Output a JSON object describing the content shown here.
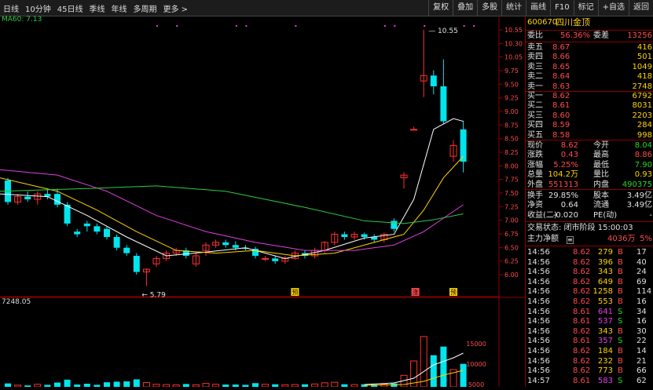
{
  "toolbar": {
    "left_items": [
      "日线",
      "10分钟",
      "45日线",
      "季线",
      "年线",
      "多周期",
      "更多 >"
    ],
    "right_items": [
      "复权",
      "叠加",
      "多股",
      "统计",
      "画线",
      "F10",
      "标记",
      "+自选",
      "返回"
    ]
  },
  "chart": {
    "ma_label": "MA60: 7.13",
    "volume_label": "7248.05",
    "price_ticks": [
      "10.55",
      "10.30",
      "10.05",
      "9.75",
      "9.50",
      "9.25",
      "9.00",
      "8.75",
      "8.50",
      "8.25",
      "8.00",
      "7.75",
      "7.50",
      "7.25",
      "7.00",
      "6.75",
      "6.50",
      "6.25",
      "6.00"
    ],
    "volume_ticks": [
      "15000",
      "10000",
      "5000"
    ],
    "high_label": "10.55",
    "low_label": "5.79",
    "markers": [
      "预",
      "涨",
      "预"
    ]
  },
  "quote": {
    "code": "600670",
    "name": "四川金顶",
    "weibi_label": "委比",
    "weibi_value": "56.36%",
    "weicha_label": "委差",
    "weicha_value": "13256",
    "asks": [
      {
        "label": "卖五",
        "price": "8.67",
        "vol": "416"
      },
      {
        "label": "卖四",
        "price": "8.66",
        "vol": "501"
      },
      {
        "label": "卖三",
        "price": "8.65",
        "vol": "1049"
      },
      {
        "label": "卖二",
        "price": "8.64",
        "vol": "418"
      },
      {
        "label": "卖一",
        "price": "8.63",
        "vol": "2748"
      }
    ],
    "bids": [
      {
        "label": "买一",
        "price": "8.62",
        "vol": "6792"
      },
      {
        "label": "买二",
        "price": "8.61",
        "vol": "8031"
      },
      {
        "label": "买三",
        "price": "8.60",
        "vol": "2203"
      },
      {
        "label": "买四",
        "price": "8.59",
        "vol": "284"
      },
      {
        "label": "买五",
        "price": "8.58",
        "vol": "998"
      }
    ],
    "stats": [
      {
        "l1": "现价",
        "v1": "8.62",
        "l2": "今开",
        "v2": "8.04"
      },
      {
        "l1": "涨跌",
        "v1": "0.43",
        "l2": "最高",
        "v2": "8.86"
      },
      {
        "l1": "涨幅",
        "v1": "5.25%",
        "l2": "最低",
        "v2": "7.90"
      },
      {
        "l1": "总量",
        "v1": "104.2万",
        "l2": "量比",
        "v2": "0.93"
      },
      {
        "l1": "外盘",
        "v1": "551313",
        "l2": "内盘",
        "v2": "490375"
      }
    ],
    "stats2": [
      {
        "l1": "换手",
        "v1": "29.85%",
        "l2": "股本",
        "v2": "3.49亿"
      },
      {
        "l1": "净资",
        "v1": "0.64",
        "l2": "流通",
        "v2": "3.49亿"
      },
      {
        "l1": "收益(二)",
        "v1": "-0.020",
        "l2": "PE(动)",
        "v2": "-"
      }
    ],
    "trade_status": "交易状态: 闭市阶段 15:00:03",
    "main_force_label": "主力净额",
    "main_force_value": "4036万",
    "main_force_pct": "5%",
    "ticks": [
      {
        "t": "14:56",
        "p": "8.62",
        "v": "279",
        "s": "B",
        "n": "17"
      },
      {
        "t": "14:56",
        "p": "8.62",
        "v": "396",
        "s": "B",
        "n": "40"
      },
      {
        "t": "14:56",
        "p": "8.62",
        "v": "343",
        "s": "B",
        "n": "24"
      },
      {
        "t": "14:56",
        "p": "8.62",
        "v": "649",
        "s": "B",
        "n": "69"
      },
      {
        "t": "14:56",
        "p": "8.62",
        "v": "1258",
        "s": "B",
        "n": "114"
      },
      {
        "t": "14:56",
        "p": "8.62",
        "v": "553",
        "s": "B",
        "n": "16"
      },
      {
        "t": "14:56",
        "p": "8.61",
        "v": "641",
        "s": "S",
        "n": "34"
      },
      {
        "t": "14:56",
        "p": "8.61",
        "v": "537",
        "s": "S",
        "n": "16"
      },
      {
        "t": "14:56",
        "p": "8.62",
        "v": "343",
        "s": "B",
        "n": "30"
      },
      {
        "t": "14:56",
        "p": "8.61",
        "v": "357",
        "s": "S",
        "n": "22"
      },
      {
        "t": "14:56",
        "p": "8.62",
        "v": "184",
        "s": "B",
        "n": "14"
      },
      {
        "t": "14:56",
        "p": "8.62",
        "v": "232",
        "s": "B",
        "n": "21"
      },
      {
        "t": "14:56",
        "p": "8.62",
        "v": "773",
        "s": "B",
        "n": "66"
      },
      {
        "t": "14:57",
        "p": "8.61",
        "v": "583",
        "s": "S",
        "n": "62"
      }
    ]
  },
  "colors": {
    "up": "#ff4b4b",
    "down": "#24d924",
    "bull_candle": "#00e5ee",
    "bear_candle": "#ff3030",
    "ma5": "#ffffff",
    "ma10": "#ffd400",
    "ma20": "#e040e0",
    "ma60": "#2ecc40"
  }
}
